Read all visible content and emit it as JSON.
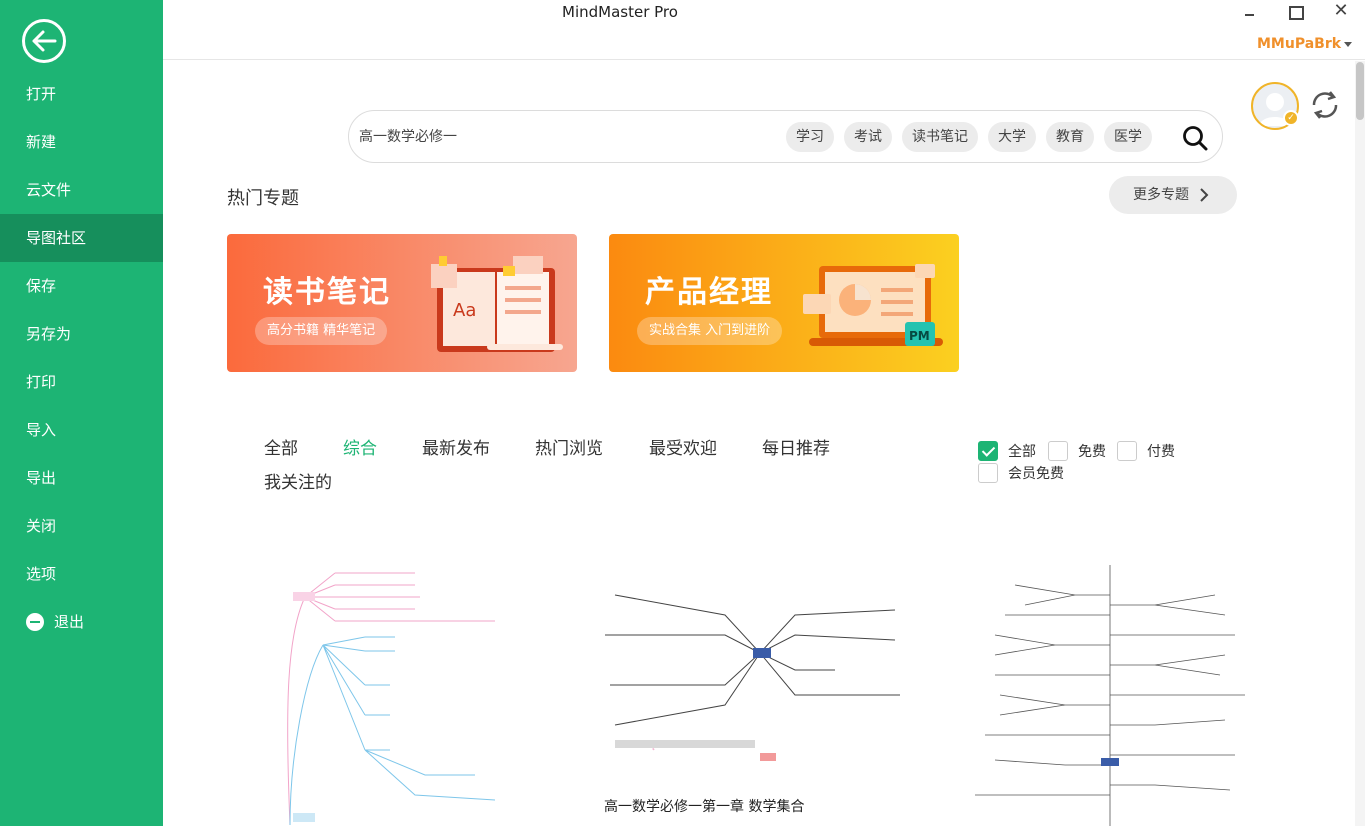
{
  "window": {
    "title": "MindMaster Pro",
    "close_glyph": "✕",
    "user_name": "MMuPaBrk"
  },
  "sidebar": {
    "items": [
      {
        "label": "打开"
      },
      {
        "label": "新建"
      },
      {
        "label": "云文件"
      },
      {
        "label": "导图社区"
      },
      {
        "label": "保存"
      },
      {
        "label": "另存为"
      },
      {
        "label": "打印"
      },
      {
        "label": "导入"
      },
      {
        "label": "导出"
      },
      {
        "label": "关闭"
      },
      {
        "label": "选项"
      }
    ],
    "exit_label": "退出",
    "active_index": 3
  },
  "search": {
    "placeholder": "高一数学必修一",
    "tags": [
      "学习",
      "考试",
      "读书笔记",
      "大学",
      "教育",
      "医学"
    ]
  },
  "topics": {
    "title": "热门专题",
    "more_label": "更多专题",
    "banners": [
      {
        "title": "读书笔记",
        "subtitle": "高分书籍 精华笔记",
        "icon_text": "Aa"
      },
      {
        "title": "产品经理",
        "subtitle": "实战合集 入门到进阶",
        "icon_text": "PM"
      }
    ]
  },
  "filters": {
    "tabs": [
      "全部",
      "综合",
      "最新发布",
      "热门浏览",
      "最受欢迎",
      "每日推荐",
      "我关注的"
    ],
    "active_tab": 1,
    "price_options": [
      {
        "label": "全部",
        "checked": true
      },
      {
        "label": "免费",
        "checked": false
      },
      {
        "label": "付费",
        "checked": false
      },
      {
        "label": "会员免费",
        "checked": false
      }
    ]
  },
  "cards": [
    {
      "title": ""
    },
    {
      "title": "高一数学必修一第一章 数学集合"
    },
    {
      "title": ""
    }
  ],
  "colors": {
    "brand_green": "#1db474",
    "sidebar_active": "#168f5c",
    "user_orange": "#f0902b"
  }
}
